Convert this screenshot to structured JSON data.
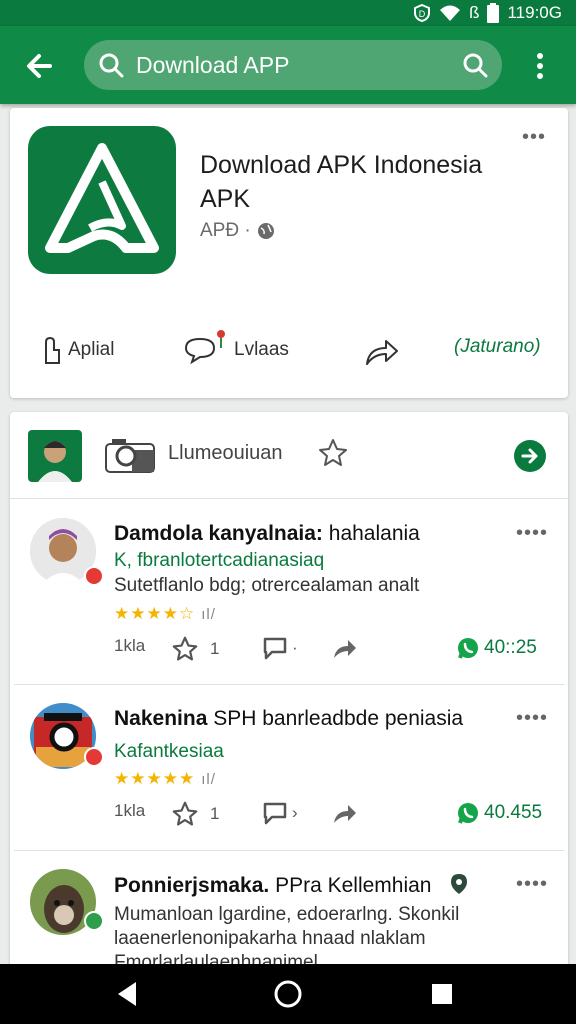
{
  "status_bar": {
    "time": "119:0G",
    "network": "ß"
  },
  "search": {
    "query": "Download APP"
  },
  "app": {
    "title": "Download APK Indonesia APK",
    "subtitle": "APÐ ·",
    "actions": {
      "info": "Aplial",
      "reviews": "Lvlaas",
      "install": "(Jaturano)"
    }
  },
  "reviews_header": {
    "label": "Llumeouiuan"
  },
  "reviews": [
    {
      "title": "Damdola kanyalnaia:",
      "title_rest": "hahalania",
      "subtitle": "K, fbranlotertcadianasiaq",
      "body": "Sutetflanlo bdg; otrercealaman analt",
      "stars": "★★★★☆",
      "star_count": "ıl/",
      "meta_left": "1kla",
      "meta_like": "1",
      "meta_comment": "·",
      "count": "40::25"
    },
    {
      "title": "Nakenina",
      "title_rest": "SPH banrleadbde peniasia",
      "subtitle": "Kafantkesiaa",
      "body": "",
      "stars": "★★★★★",
      "star_count": "ıl/",
      "meta_left": "1kla",
      "meta_like": "1",
      "meta_comment": "›",
      "count": "40.455"
    },
    {
      "title": "Ponnierjsmaka.",
      "title_rest": "PPra Kellemhian",
      "subtitle": "",
      "body": "Mumanloan lgardine, edoerarlng. Skonkil\nlaaenerlenonipakarha hnaad nlaklam\nFmorlarlaulaenhnanimel",
      "stars": "",
      "star_count": "",
      "meta_left": "",
      "meta_like": "",
      "meta_comment": "",
      "count": ""
    }
  ],
  "colors": {
    "primary": "#108a47",
    "dark": "#0a7a3f",
    "star": "#f4b400"
  }
}
